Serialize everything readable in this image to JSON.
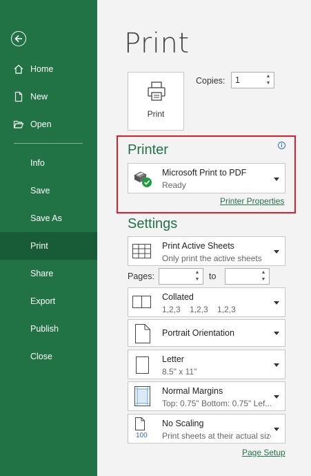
{
  "nav": {
    "back_icon": "back-arrow-icon",
    "items": [
      {
        "label": "Home",
        "icon": "home-icon"
      },
      {
        "label": "New",
        "icon": "new-document-icon"
      },
      {
        "label": "Open",
        "icon": "open-folder-icon"
      },
      {
        "label": "Info"
      },
      {
        "label": "Save"
      },
      {
        "label": "Save As"
      },
      {
        "label": "Print",
        "active": true
      },
      {
        "label": "Share"
      },
      {
        "label": "Export"
      },
      {
        "label": "Publish"
      },
      {
        "label": "Close"
      }
    ]
  },
  "main": {
    "title": "Print",
    "print_button_label": "Print",
    "copies_label": "Copies:",
    "copies_value": "1"
  },
  "printer": {
    "heading": "Printer",
    "name": "Microsoft Print to PDF",
    "status": "Ready",
    "properties_link": "Printer Properties"
  },
  "settings": {
    "heading": "Settings",
    "what": {
      "title": "Print Active Sheets",
      "subtitle": "Only print the active sheets"
    },
    "pages_label": "Pages:",
    "to_label": "to",
    "pages_from": "",
    "pages_to": "",
    "collation": {
      "title": "Collated",
      "subtitle": "1,2,3    1,2,3    1,2,3"
    },
    "orientation": {
      "title": "Portrait Orientation"
    },
    "paper": {
      "title": "Letter",
      "subtitle": "8.5\" x 11\""
    },
    "margins": {
      "title": "Normal Margins",
      "subtitle": "Top: 0.75\" Bottom: 0.75\" Lef..."
    },
    "scaling": {
      "title": "No Scaling",
      "subtitle": "Print sheets at their actual size",
      "icon_text": "100"
    },
    "page_setup_link": "Page Setup"
  },
  "colors": {
    "sidebar_bg": "#217346",
    "sidebar_active": "#185c37",
    "accent": "#217346",
    "highlight_border": "#e21b2a"
  }
}
